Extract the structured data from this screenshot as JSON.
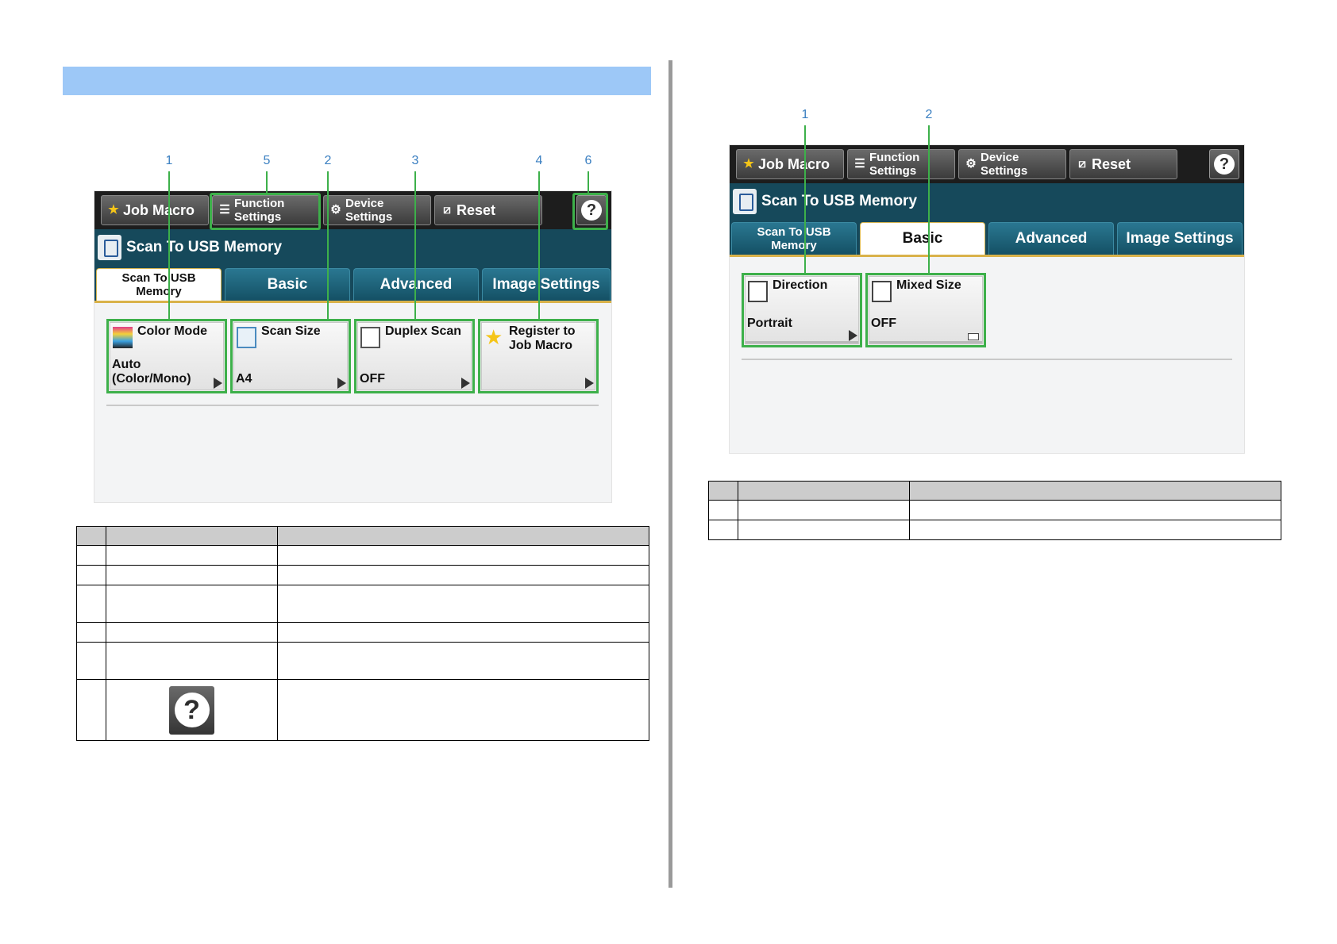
{
  "left_screen": {
    "callouts": [
      "1",
      "5",
      "2",
      "3",
      "4",
      "6"
    ],
    "toolbar": {
      "job_macro": "Job Macro",
      "function_settings": [
        "Function",
        "Settings"
      ],
      "device_settings": [
        "Device",
        "Settings"
      ],
      "reset": "Reset",
      "help": "?"
    },
    "screen_title": "Scan To USB Memory",
    "tabs": {
      "scan_to_usb": [
        "Scan To USB",
        "Memory"
      ],
      "basic": "Basic",
      "advanced": "Advanced",
      "image_settings": "Image Settings"
    },
    "tiles": [
      {
        "label": "Color Mode",
        "value": [
          "Auto",
          " (Color/Mono)"
        ],
        "icon": "color-mode-icon"
      },
      {
        "label": "Scan Size",
        "value": [
          "A4"
        ],
        "icon": "scan-size-icon"
      },
      {
        "label": "Duplex Scan",
        "value": [
          "OFF"
        ],
        "icon": "duplex-scan-icon"
      },
      {
        "label": "Register to\nJob Macro",
        "value": [
          ""
        ],
        "icon": "star-plus-icon"
      }
    ]
  },
  "right_screen": {
    "callouts": [
      "1",
      "2"
    ],
    "toolbar": {
      "job_macro": "Job Macro",
      "function_settings": [
        "Function",
        "Settings"
      ],
      "device_settings": [
        "Device",
        "Settings"
      ],
      "reset": "Reset",
      "help": "?"
    },
    "screen_title": "Scan To USB Memory",
    "tabs": {
      "scan_to_usb": [
        "Scan To USB",
        "Memory"
      ],
      "basic": "Basic",
      "advanced": "Advanced",
      "image_settings": "Image Settings"
    },
    "tiles": [
      {
        "label": "Direction",
        "value": "Portrait",
        "icon": "direction-icon"
      },
      {
        "label": "Mixed Size",
        "value": "OFF",
        "icon": "mixed-size-icon"
      }
    ]
  },
  "left_table": {
    "help_glyph": "?"
  },
  "colors": {
    "title_bar": "#9dc8f7",
    "highlight": "#3db04a",
    "callout": "#3a7fc1",
    "panel_header": "#16495b"
  }
}
